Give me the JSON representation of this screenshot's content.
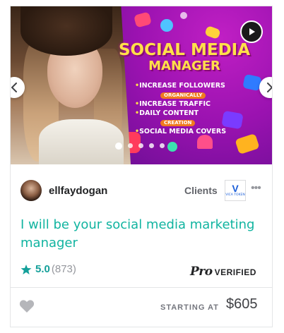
{
  "banner": {
    "headline_line1": "SOCIAL MEDIA",
    "headline_line2": "MANAGER",
    "bullets": [
      "INCREASE FOLLOWERS",
      "INCREASE TRAFFIC",
      "DAILY CONTENT",
      "SOCIAL MEDIA COVERS"
    ],
    "bullet_sub1": "ORGANICALLY",
    "bullet_sub2": "CREATION",
    "play_icon": "play-icon",
    "prev_icon": "chevron-left-icon",
    "next_icon": "chevron-right-icon",
    "slide_count": 5,
    "active_slide": 0
  },
  "seller": {
    "username": "ellfaydogan",
    "clients_label": "Clients",
    "client_logo_text": "VICA TOKEN"
  },
  "gig": {
    "title": "I will be your social media marketing manager"
  },
  "rating": {
    "value": "5.0",
    "count": "(873)",
    "star_color": "#1dbf73"
  },
  "badge": {
    "pro": "Pro",
    "verified": "VERIFIED"
  },
  "footer": {
    "starting_at": "STARTING AT",
    "price": "$605"
  },
  "colors": {
    "accent": "#1dbf73",
    "title_teal": "#11b4a0",
    "banner_purple": "#9a12b0",
    "headline_yellow": "#ffe04a"
  }
}
